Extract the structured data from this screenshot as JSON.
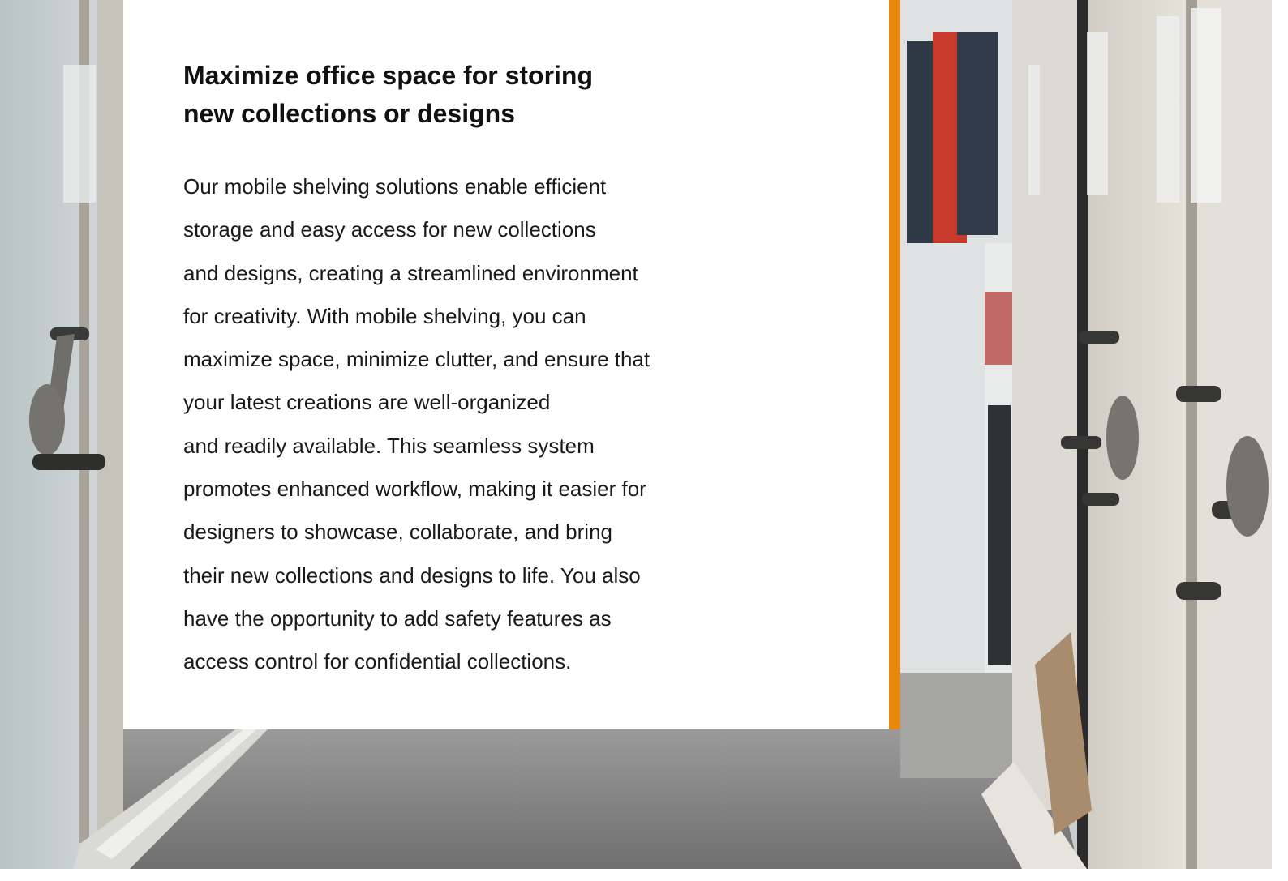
{
  "section": {
    "heading_lines": [
      "Maximize office space for storing",
      "new collections or designs"
    ],
    "body_lines": [
      "Our mobile shelving solutions enable efficient",
      "storage and easy access for new collections",
      "and designs, creating a streamlined environment",
      "for creativity. With mobile shelving, you can",
      "maximize space, minimize clutter, and ensure that",
      "your latest creations are well-organized",
      "and readily available. This seamless system",
      "promotes enhanced workflow, making it easier for",
      "designers to showcase, collaborate, and bring",
      "their new collections and designs to life. You also",
      "have the opportunity to add safety features as",
      "access control for confidential collections."
    ]
  },
  "colors": {
    "accent": "#e8870a",
    "card_background": "#ffffff",
    "text": "#1a1a1a"
  }
}
